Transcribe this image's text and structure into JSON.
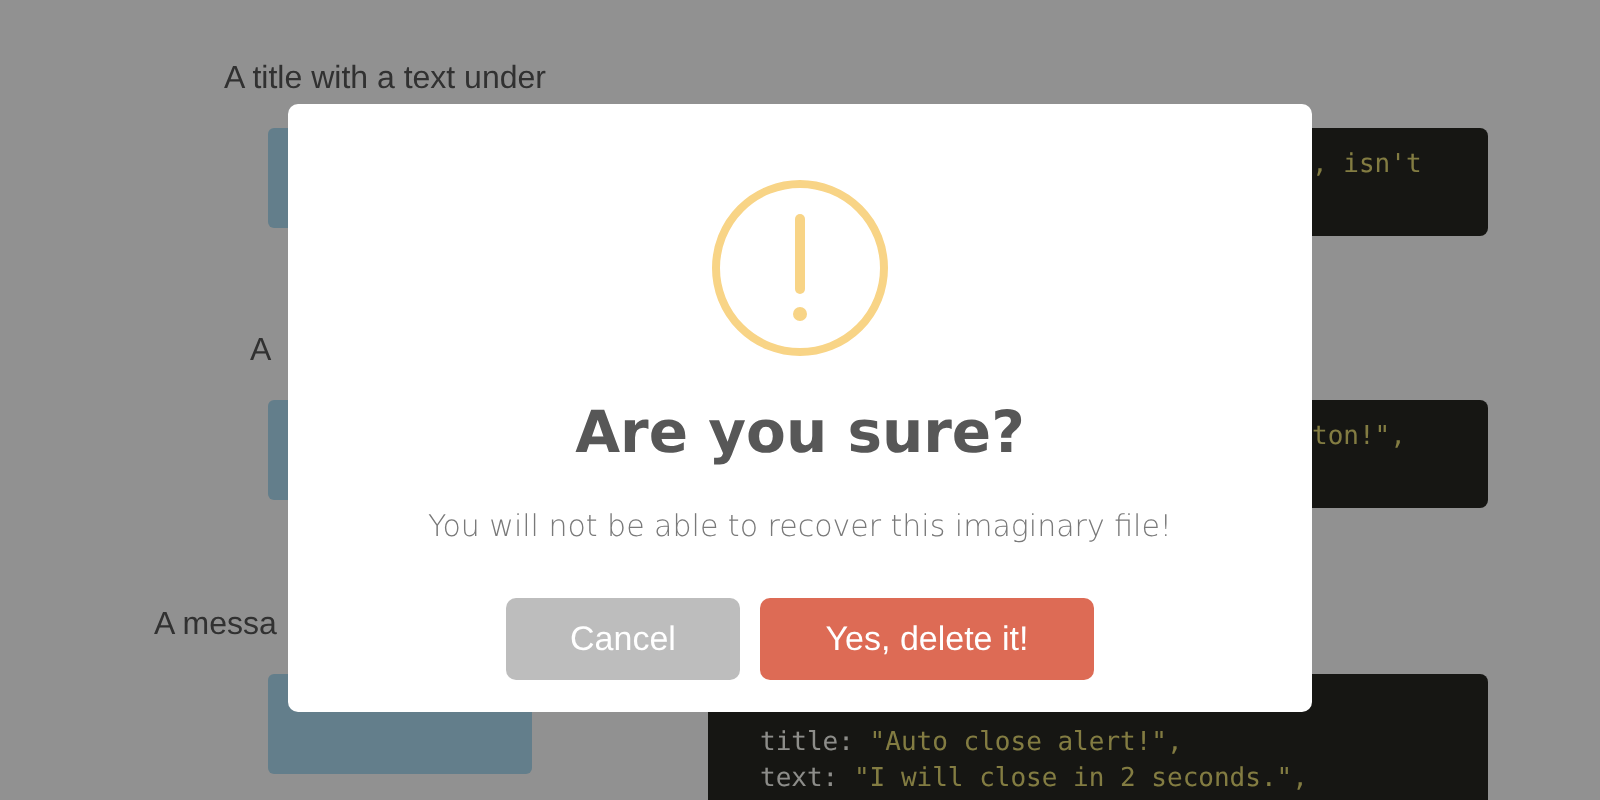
{
  "page": {
    "sections": [
      {
        "label": "A title with a text under",
        "code": [
          ", isn't"
        ]
      },
      {
        "label": "A",
        "code": [
          "ton!\","
        ]
      },
      {
        "label": "A messa",
        "code": [
          "title: \"Auto close alert!\",",
          "text: \"I will close in 2 seconds.\","
        ]
      }
    ]
  },
  "dialog": {
    "title": "Are you sure?",
    "text": "You will not be able to recover this imaginary file!",
    "buttons": [
      {
        "label": "Cancel",
        "kind": "cancel"
      },
      {
        "label": "Yes, delete it!",
        "kind": "confirm"
      }
    ]
  }
}
